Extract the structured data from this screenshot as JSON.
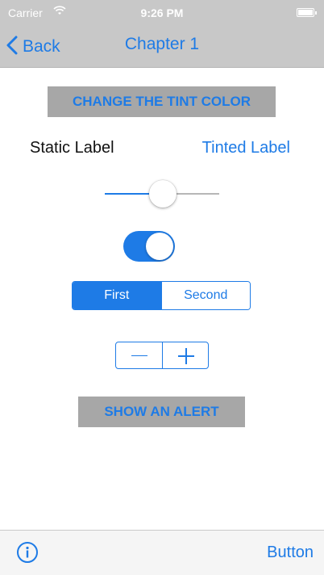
{
  "status_bar": {
    "carrier": "Carrier",
    "time": "9:26 PM",
    "wifi_icon": "wifi-icon",
    "battery_icon": "battery-icon"
  },
  "nav_bar": {
    "back_label": "Back",
    "title": "Chapter 1",
    "back_icon": "chevron-left-icon"
  },
  "content": {
    "tint_button_label": "CHANGE THE TINT COLOR",
    "static_label": "Static Label",
    "tinted_label": "Tinted Label",
    "slider_value": 0.5,
    "switch_on": true,
    "segments": [
      "First",
      "Second"
    ],
    "selected_segment": "First",
    "stepper_icons": [
      "minus-icon",
      "plus-icon"
    ],
    "alert_button_label": "SHOW AN ALERT"
  },
  "toolbar": {
    "info_icon": "info-icon",
    "button_label": "Button"
  },
  "colors": {
    "tint": "#1e7be6",
    "bar_background": "#c8c8c8",
    "button_background": "#a7a7a7",
    "toolbar_background": "#f5f5f5"
  }
}
